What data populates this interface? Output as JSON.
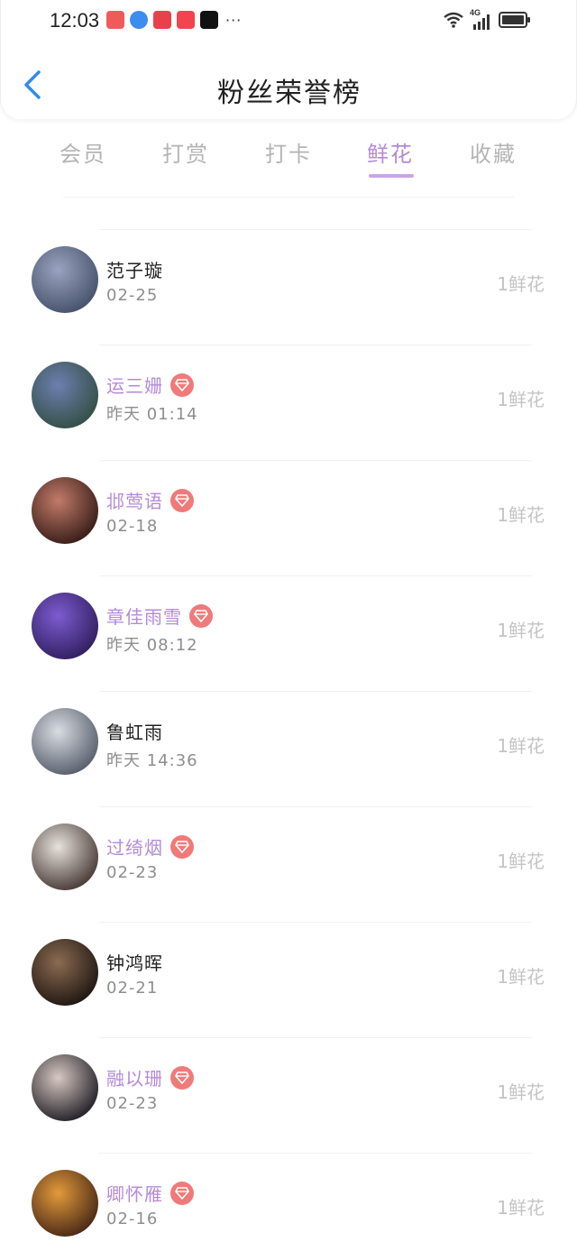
{
  "status_bar": {
    "time": "12:03",
    "app_icons": [
      {
        "name": "red-shop-icon",
        "color": "#f05a5a"
      },
      {
        "name": "blue-browser-icon",
        "color": "#3d8cf0"
      },
      {
        "name": "red-app-icon",
        "color": "#e8414c"
      },
      {
        "name": "red-taobao-icon",
        "color": "#f0444e"
      },
      {
        "name": "black-app-icon",
        "color": "#111111"
      }
    ],
    "more": "···",
    "network": "4G"
  },
  "header": {
    "title": "粉丝荣誉榜"
  },
  "tabs": [
    {
      "label": "会员",
      "active": false
    },
    {
      "label": "打赏",
      "active": false
    },
    {
      "label": "打卡",
      "active": false
    },
    {
      "label": "鲜花",
      "active": true
    },
    {
      "label": "收藏",
      "active": false
    }
  ],
  "colors": {
    "accent": "#b48ad8",
    "badge": "#f07a7a",
    "muted": "#c4c4c4"
  },
  "fans": [
    {
      "name": "范子璇",
      "time": "02-25",
      "vip": false,
      "count": "1鲜花",
      "avatar_colors": [
        "#9aa3bf",
        "#3e4a63"
      ]
    },
    {
      "name": "运三姗",
      "time": "昨天 01:14",
      "vip": true,
      "count": "1鲜花",
      "avatar_colors": [
        "#6c7fb0",
        "#2f4a3b"
      ]
    },
    {
      "name": "邶莺语",
      "time": "02-18",
      "vip": true,
      "count": "1鲜花",
      "avatar_colors": [
        "#c27b6a",
        "#2a1410"
      ]
    },
    {
      "name": "章佳雨雪",
      "time": "昨天 08:12",
      "vip": true,
      "count": "1鲜花",
      "avatar_colors": [
        "#7d5bd0",
        "#2a1a55"
      ]
    },
    {
      "name": "鲁虹雨",
      "time": "昨天 14:36",
      "vip": false,
      "count": "1鲜花",
      "avatar_colors": [
        "#d9dde3",
        "#4b5260"
      ]
    },
    {
      "name": "过绮烟",
      "time": "02-23",
      "vip": true,
      "count": "1鲜花",
      "avatar_colors": [
        "#e7e2dc",
        "#3a2b26"
      ]
    },
    {
      "name": "钟鸿晖",
      "time": "02-21",
      "vip": false,
      "count": "1鲜花",
      "avatar_colors": [
        "#8c6b52",
        "#150f0c"
      ]
    },
    {
      "name": "融以珊",
      "time": "02-23",
      "vip": true,
      "count": "1鲜花",
      "avatar_colors": [
        "#d7c8c2",
        "#121018"
      ]
    },
    {
      "name": "卿怀雁",
      "time": "02-16",
      "vip": true,
      "count": "1鲜花",
      "avatar_colors": [
        "#e39a3c",
        "#3a1e12"
      ]
    }
  ]
}
